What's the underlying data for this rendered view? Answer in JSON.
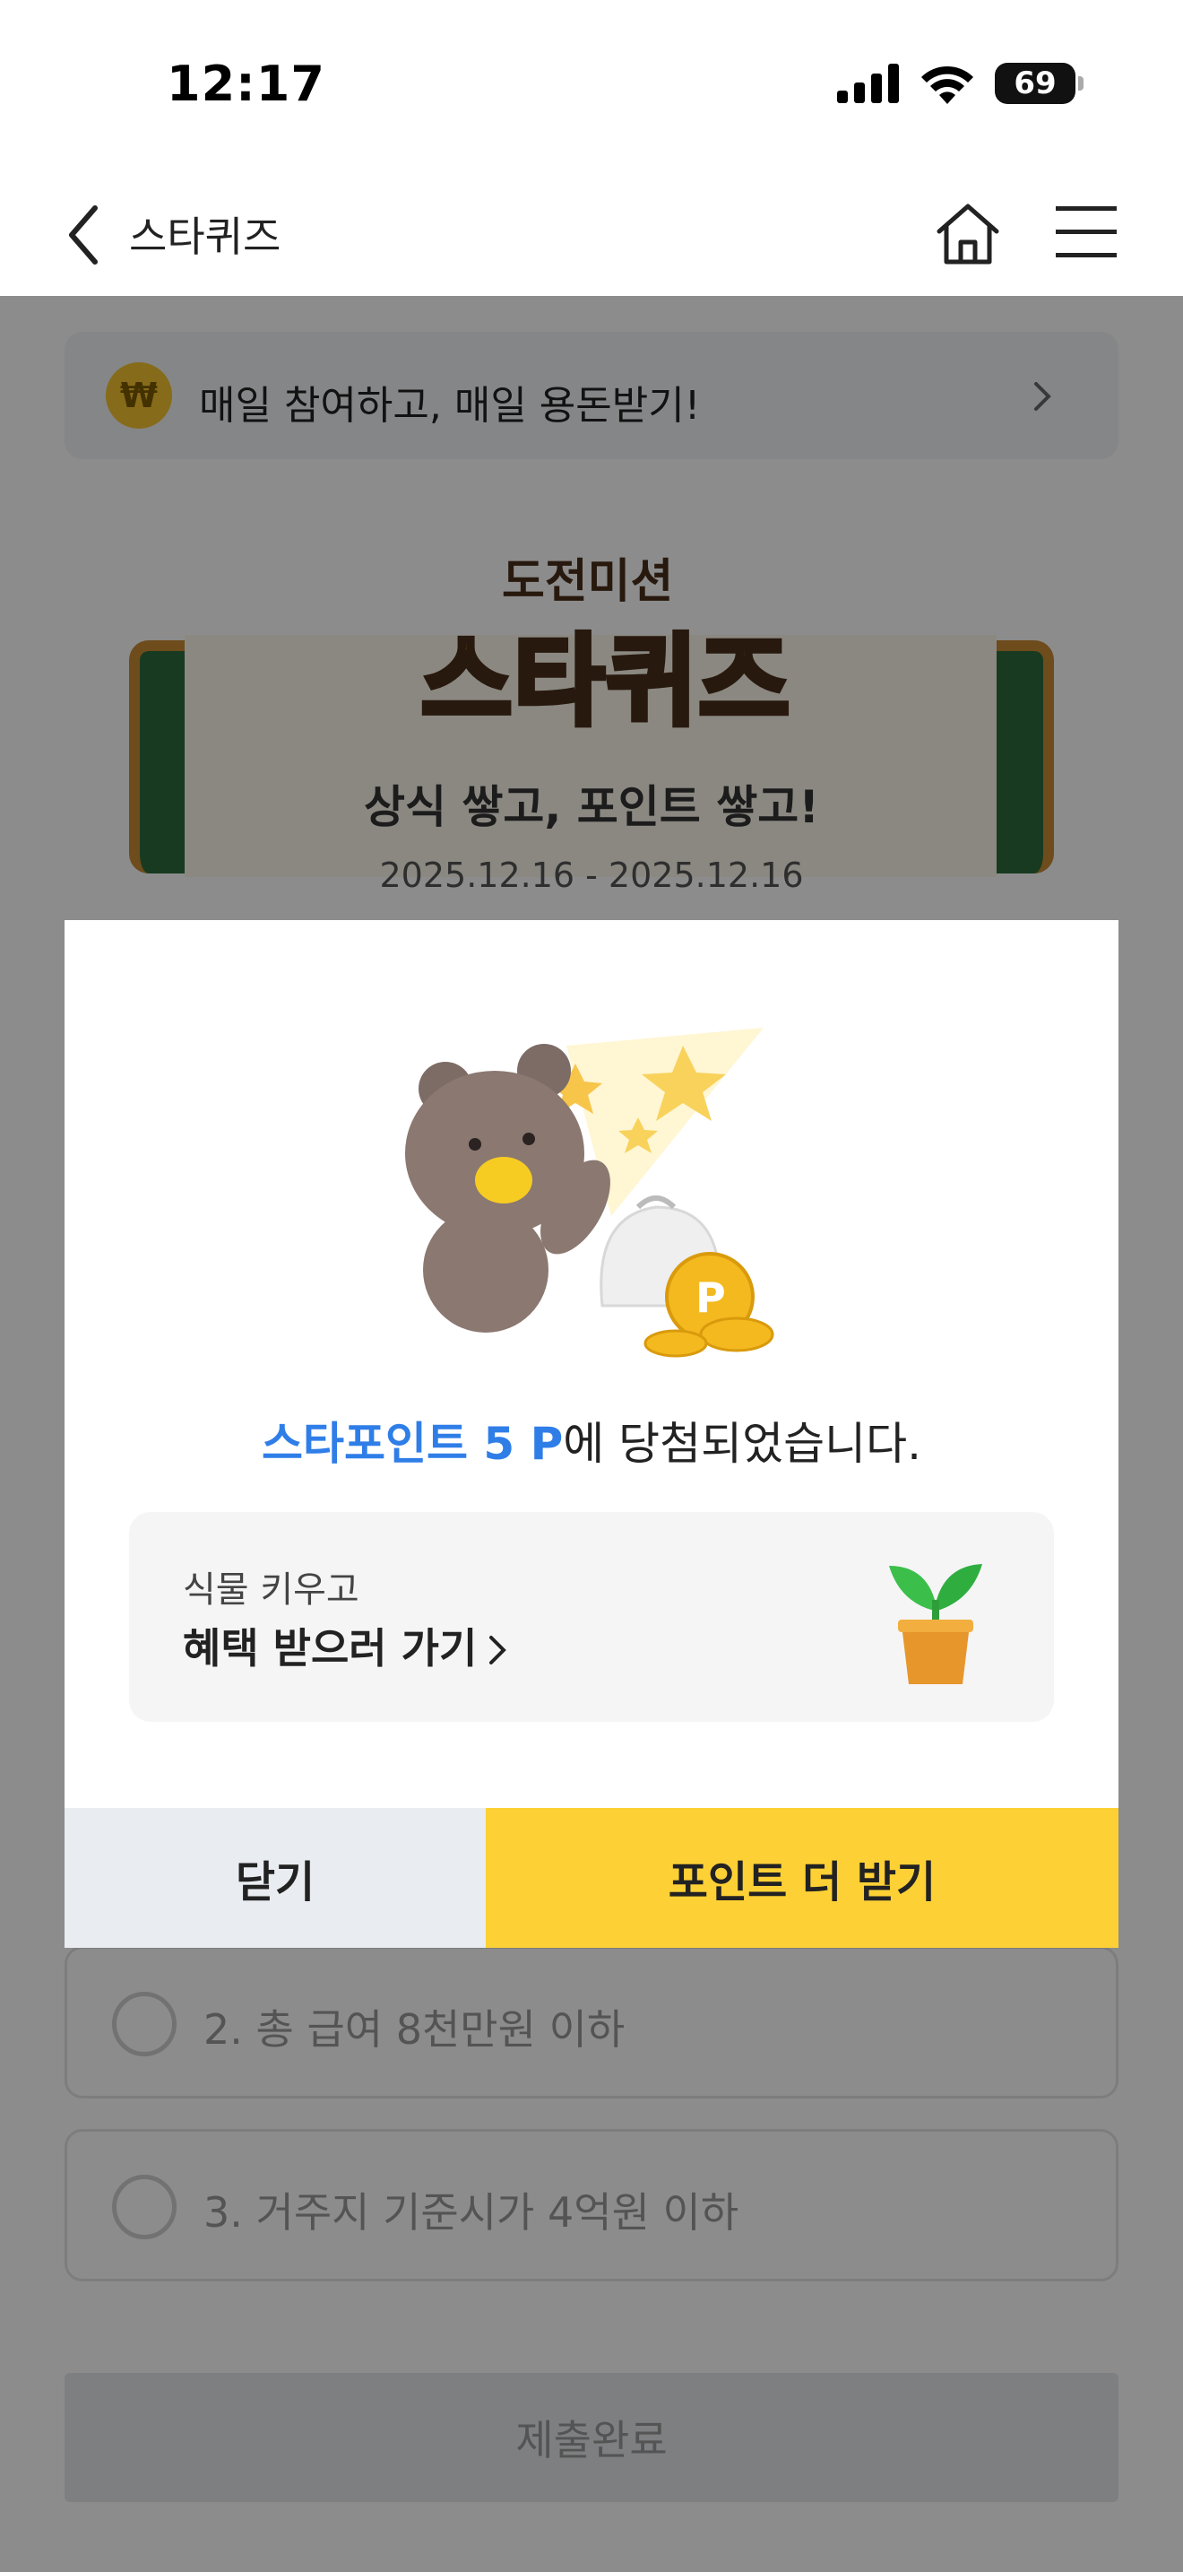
{
  "status_bar": {
    "time": "12:17",
    "battery": "69"
  },
  "header": {
    "title": "스타퀴즈"
  },
  "banner": {
    "text": "매일 참여하고, 매일 용돈받기!",
    "coin_symbol": "₩"
  },
  "quiz": {
    "logo_badge": "도전미션",
    "logo_main": "스타퀴즈",
    "title": "상식 쌓고, 포인트 쌓고!",
    "date": "2025.12.16 - 2025.12.16",
    "options": [
      {
        "label": "2. 총 급여 8천만원 이하"
      },
      {
        "label": "3. 거주지 기준시가 4억원 이하"
      }
    ],
    "submit_label": "제출완료"
  },
  "modal": {
    "result_highlight": "스타포인트 5 P",
    "result_suffix": "에 당첨되었습니다.",
    "benefit_sub": "식물 키우고",
    "benefit_main": "혜택 받으러 가기",
    "close_label": "닫기",
    "more_label": "포인트 더 받기"
  },
  "colors": {
    "accent_blue": "#2f7ee8",
    "accent_yellow": "#fdd135",
    "close_bg": "#e9ecf0"
  }
}
